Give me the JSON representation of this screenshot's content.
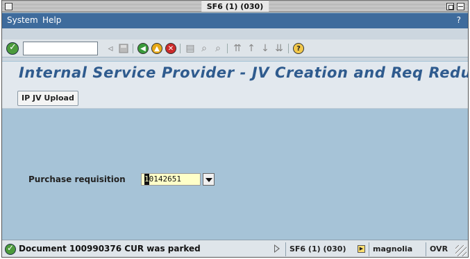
{
  "window": {
    "title": "SF6 (1) (030)"
  },
  "menubar": {
    "items": [
      "System",
      "Help"
    ],
    "help_indicator": "?"
  },
  "toolbar": {
    "command_field_value": "",
    "icons": [
      "enter-icon",
      "back-icon",
      "save-icon",
      "back-nav-icon",
      "exit-icon",
      "cancel-icon",
      "print-icon",
      "find-icon",
      "find-next-icon",
      "first-page-icon",
      "previous-page-icon",
      "next-page-icon",
      "last-page-icon",
      "help-icon"
    ]
  },
  "page": {
    "title": "Internal Service Provider - JV Creation and Req Reduction"
  },
  "app_toolbar": {
    "button_label": "IP JV Upload"
  },
  "form": {
    "purchase_requisition_label": "Purchase requisition",
    "purchase_requisition_first_char": "1",
    "purchase_requisition_rest": "0142651"
  },
  "status": {
    "message": "Document 100990376 CUR was parked",
    "system": "SF6 (1) (030)",
    "host": "magnolia",
    "mode": "OVR"
  },
  "colors": {
    "menubar": "#3e6b9c",
    "content_background": "#a6c3d7",
    "title_color": "#2f5b8e",
    "input_background": "#ffffc8",
    "success_green": "#4c9b3c"
  }
}
